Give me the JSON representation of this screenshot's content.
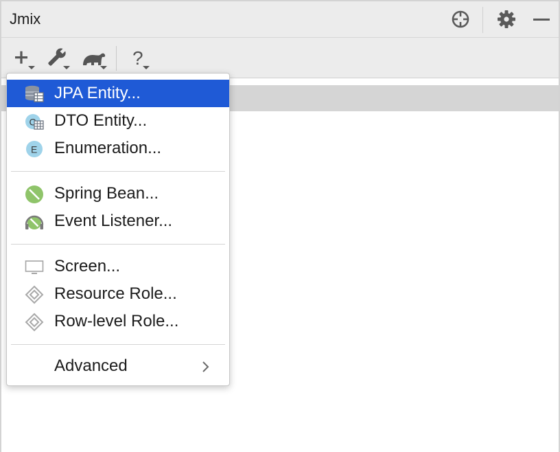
{
  "window": {
    "title": "Jmix"
  },
  "title_icons": [
    "crosshair-icon",
    "gear-icon",
    "minimize-icon"
  ],
  "toolbar": {
    "items": [
      "add-icon",
      "wrench-icon",
      "gradle-icon",
      "help-icon"
    ]
  },
  "menu": {
    "accent_color": "#1f5ad6",
    "groups": [
      [
        {
          "label": "JPA Entity...",
          "icon": "jpa-entity-icon",
          "active": true
        },
        {
          "label": "DTO Entity...",
          "icon": "dto-entity-icon"
        },
        {
          "label": "Enumeration...",
          "icon": "enumeration-icon",
          "badge": "E"
        }
      ],
      [
        {
          "label": "Spring Bean...",
          "icon": "spring-bean-icon"
        },
        {
          "label": "Event Listener...",
          "icon": "event-listener-icon"
        }
      ],
      [
        {
          "label": "Screen...",
          "icon": "screen-icon"
        },
        {
          "label": "Resource Role...",
          "icon": "resource-role-icon"
        },
        {
          "label": "Row-level Role...",
          "icon": "row-level-role-icon"
        }
      ],
      [
        {
          "label": "Advanced",
          "icon": "chevron-right-icon",
          "submenu": true
        }
      ]
    ]
  }
}
